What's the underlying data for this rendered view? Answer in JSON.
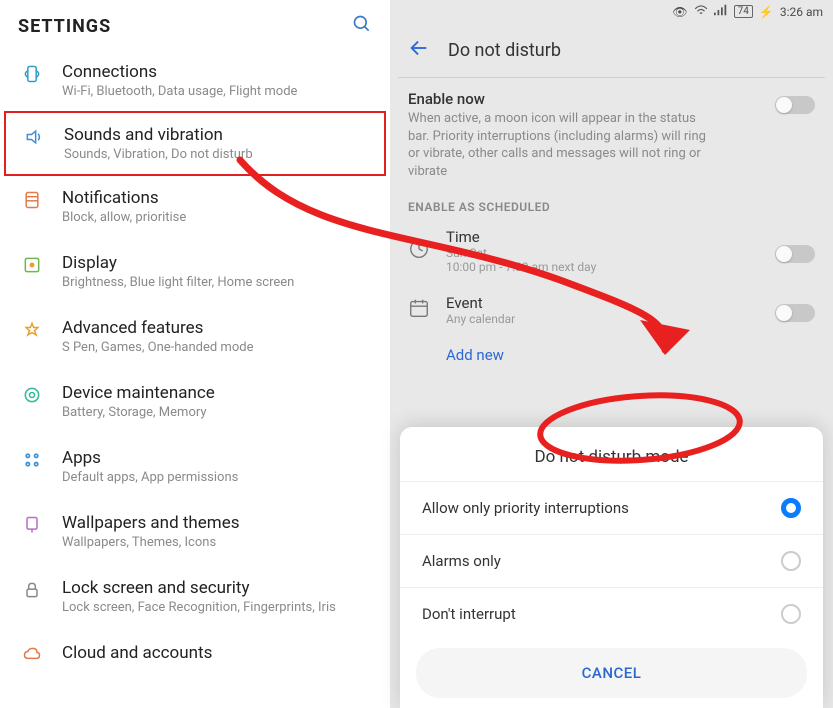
{
  "left": {
    "title": "SETTINGS",
    "items": [
      {
        "title": "Connections",
        "sub": "Wi-Fi, Bluetooth, Data usage, Flight mode",
        "icon": "connections"
      },
      {
        "title": "Sounds and vibration",
        "sub": "Sounds, Vibration, Do not disturb",
        "icon": "sound",
        "highlight": true
      },
      {
        "title": "Notifications",
        "sub": "Block, allow, prioritise",
        "icon": "notifications"
      },
      {
        "title": "Display",
        "sub": "Brightness, Blue light filter, Home screen",
        "icon": "display"
      },
      {
        "title": "Advanced features",
        "sub": "S Pen, Games, One-handed mode",
        "icon": "advanced"
      },
      {
        "title": "Device maintenance",
        "sub": "Battery, Storage, Memory",
        "icon": "maintenance"
      },
      {
        "title": "Apps",
        "sub": "Default apps, App permissions",
        "icon": "apps"
      },
      {
        "title": "Wallpapers and themes",
        "sub": "Wallpapers, Themes, Icons",
        "icon": "wallpaper"
      },
      {
        "title": "Lock screen and security",
        "sub": "Lock screen, Face Recognition, Fingerprints, Iris",
        "icon": "lock"
      },
      {
        "title": "Cloud and accounts",
        "sub": "",
        "icon": "cloud"
      }
    ]
  },
  "right": {
    "status": {
      "battery": "74",
      "time": "3:26 am"
    },
    "header": "Do not disturb",
    "enable": {
      "title": "Enable now",
      "desc": "When active, a moon icon will appear in the status bar. Priority interruptions (including alarms) will ring or vibrate, other calls and messages will not ring or vibrate"
    },
    "scheduled_label": "ENABLE AS SCHEDULED",
    "time_item": {
      "title": "Time",
      "sub": "Sun Sat",
      "sub2": "10:00 pm - 7:00 am next day"
    },
    "event_item": {
      "title": "Event",
      "sub": "Any calendar"
    },
    "add_new": "Add new",
    "modal": {
      "title": "Do not disturb mode",
      "options": [
        {
          "label": "Allow only priority interruptions",
          "selected": true
        },
        {
          "label": "Alarms only",
          "selected": false
        },
        {
          "label": "Don't interrupt",
          "selected": false
        }
      ],
      "cancel": "CANCEL"
    }
  }
}
